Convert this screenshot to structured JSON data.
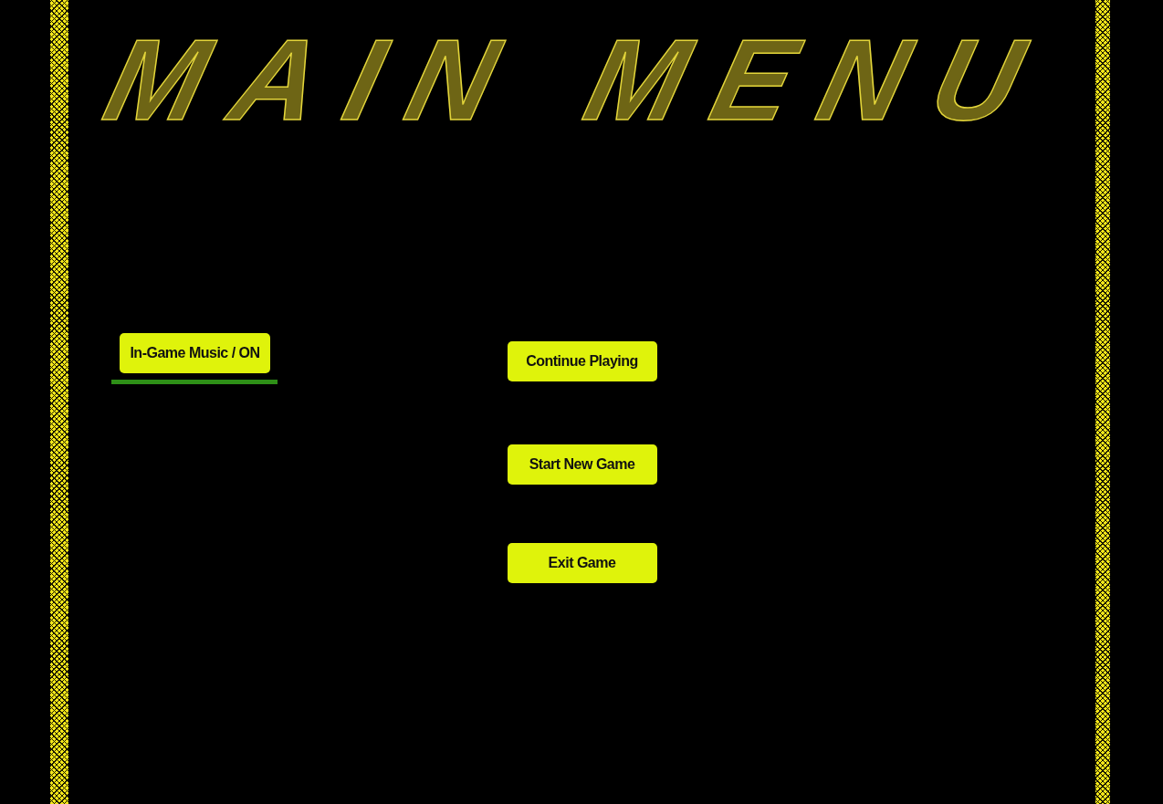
{
  "title": "MAIN MENU",
  "music_toggle": {
    "label": "In-Game Music / ON",
    "on": true
  },
  "buttons": [
    "Continue Playing",
    "Start New Game",
    "Exit Game"
  ]
}
